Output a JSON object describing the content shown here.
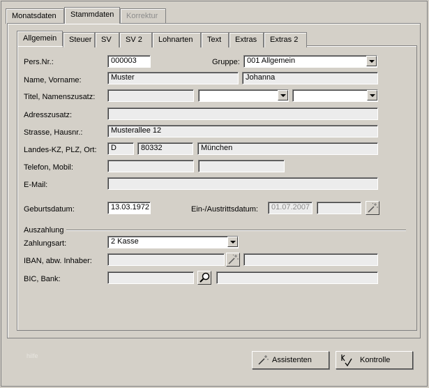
{
  "main_tabs": [
    {
      "label": "Monatsdaten"
    },
    {
      "label": "Stammdaten"
    },
    {
      "label": "Korrektur"
    }
  ],
  "inner_tabs": [
    {
      "label": "Allgemein"
    },
    {
      "label": "Steuer"
    },
    {
      "label": "SV"
    },
    {
      "label": "SV 2"
    },
    {
      "label": "Lohnarten"
    },
    {
      "label": "Text"
    },
    {
      "label": "Extras"
    },
    {
      "label": "Extras 2"
    }
  ],
  "form": {
    "persnr_label": "Pers.Nr.:",
    "persnr_value": "000003",
    "gruppe_label": "Gruppe:",
    "gruppe_value": "001 Allgemein",
    "name_label": "Name, Vorname:",
    "name_value": "Muster",
    "vorname_value": "Johanna",
    "titel_label": "Titel, Namenszusatz:",
    "titel_value": "",
    "adresszusatz_label": "Adresszusatz:",
    "adresszusatz_value": "",
    "strasse_label": "Strasse, Hausnr.:",
    "strasse_value": "Musterallee 12",
    "landes_label": "Landes-KZ, PLZ, Ort:",
    "land_value": "D",
    "plz_value": "80332",
    "ort_value": "München",
    "telefon_label": "Telefon, Mobil:",
    "telefon_value": "",
    "mobil_value": "",
    "email_label": "E-Mail:",
    "email_value": "",
    "geburt_label": "Geburtsdatum:",
    "geburt_value": "13.03.1972",
    "einaus_label": "Ein-/Austrittsdatum:",
    "eintritt_value": "01.07.2007",
    "austritt_value": ""
  },
  "auszahlung": {
    "group_label": "Auszahlung",
    "zahlungsart_label": "Zahlungsart:",
    "zahlungsart_value": "2 Kasse",
    "iban_label": "IBAN, abw. Inhaber:",
    "iban_value": "",
    "inhaber_value": "",
    "bic_label": "BIC, Bank:",
    "bic_value": "",
    "bank_value": ""
  },
  "footer": {
    "help_text": "hilfe",
    "assistenten_label": "Assistenten",
    "kontrolle_label": "Kontrolle"
  },
  "icons": {
    "wand": "magic-wand-icon",
    "search": "magnifier-icon",
    "check": "check-icon"
  }
}
